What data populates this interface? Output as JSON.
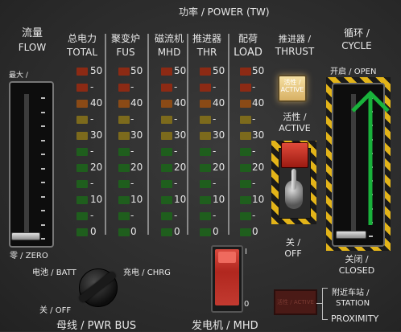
{
  "title": "功率 / POWER (TW)",
  "flow": {
    "label_cn": "流量",
    "label_en": "FLOW",
    "max_label": "最大 /",
    "zero_label": "零 / ZERO",
    "level": 0.0
  },
  "meters": [
    {
      "id": "total",
      "cn": "总电力",
      "en": "TOTAL"
    },
    {
      "id": "fus",
      "cn": "聚变炉",
      "en": "FUS"
    },
    {
      "id": "mhd",
      "cn": "磁流机",
      "en": "MHD"
    },
    {
      "id": "thr",
      "cn": "推进器",
      "en": "THR"
    },
    {
      "id": "load",
      "cn": "配荷",
      "en": "LOAD"
    }
  ],
  "scale_labels": [
    "50",
    "-",
    "40",
    "-",
    "30",
    "-",
    "20",
    "-",
    "10",
    "-",
    "0"
  ],
  "thrust": {
    "label_cn": "推进器 /",
    "label_en": "THRUST",
    "indicator_line1": "活性 /",
    "indicator_line2": "ACTIVE",
    "active_cn": "活性 /",
    "active_en": "ACTIVE",
    "off_cn": "关 /",
    "off_en": "OFF"
  },
  "cycle": {
    "label_cn": "循环 /",
    "label_en": "CYCLE",
    "open_label": "开启 / OPEN",
    "closed_cn": "关闭 /",
    "closed_en": "CLOSED",
    "level": 0.0
  },
  "bus": {
    "batt": "电池 / BATT",
    "chrg": "充电 / CHRG",
    "off": "关 / OFF",
    "title": "母线 / PWR BUS"
  },
  "mhd": {
    "one": "I",
    "zero": "0",
    "title": "发电机 / MHD"
  },
  "proximity": {
    "line1": "附近车站 /",
    "line2": "STATION",
    "line3": "PROXIMITY",
    "indicator": "活性 / ACTIVE"
  },
  "colors": {
    "red": "#8c2a14",
    "orange": "#8a4a16",
    "yellow": "#7c6a1c",
    "green": "#1f5e1d",
    "hazard_yellow": "#e3b419",
    "arrow_green": "#19b23b"
  }
}
